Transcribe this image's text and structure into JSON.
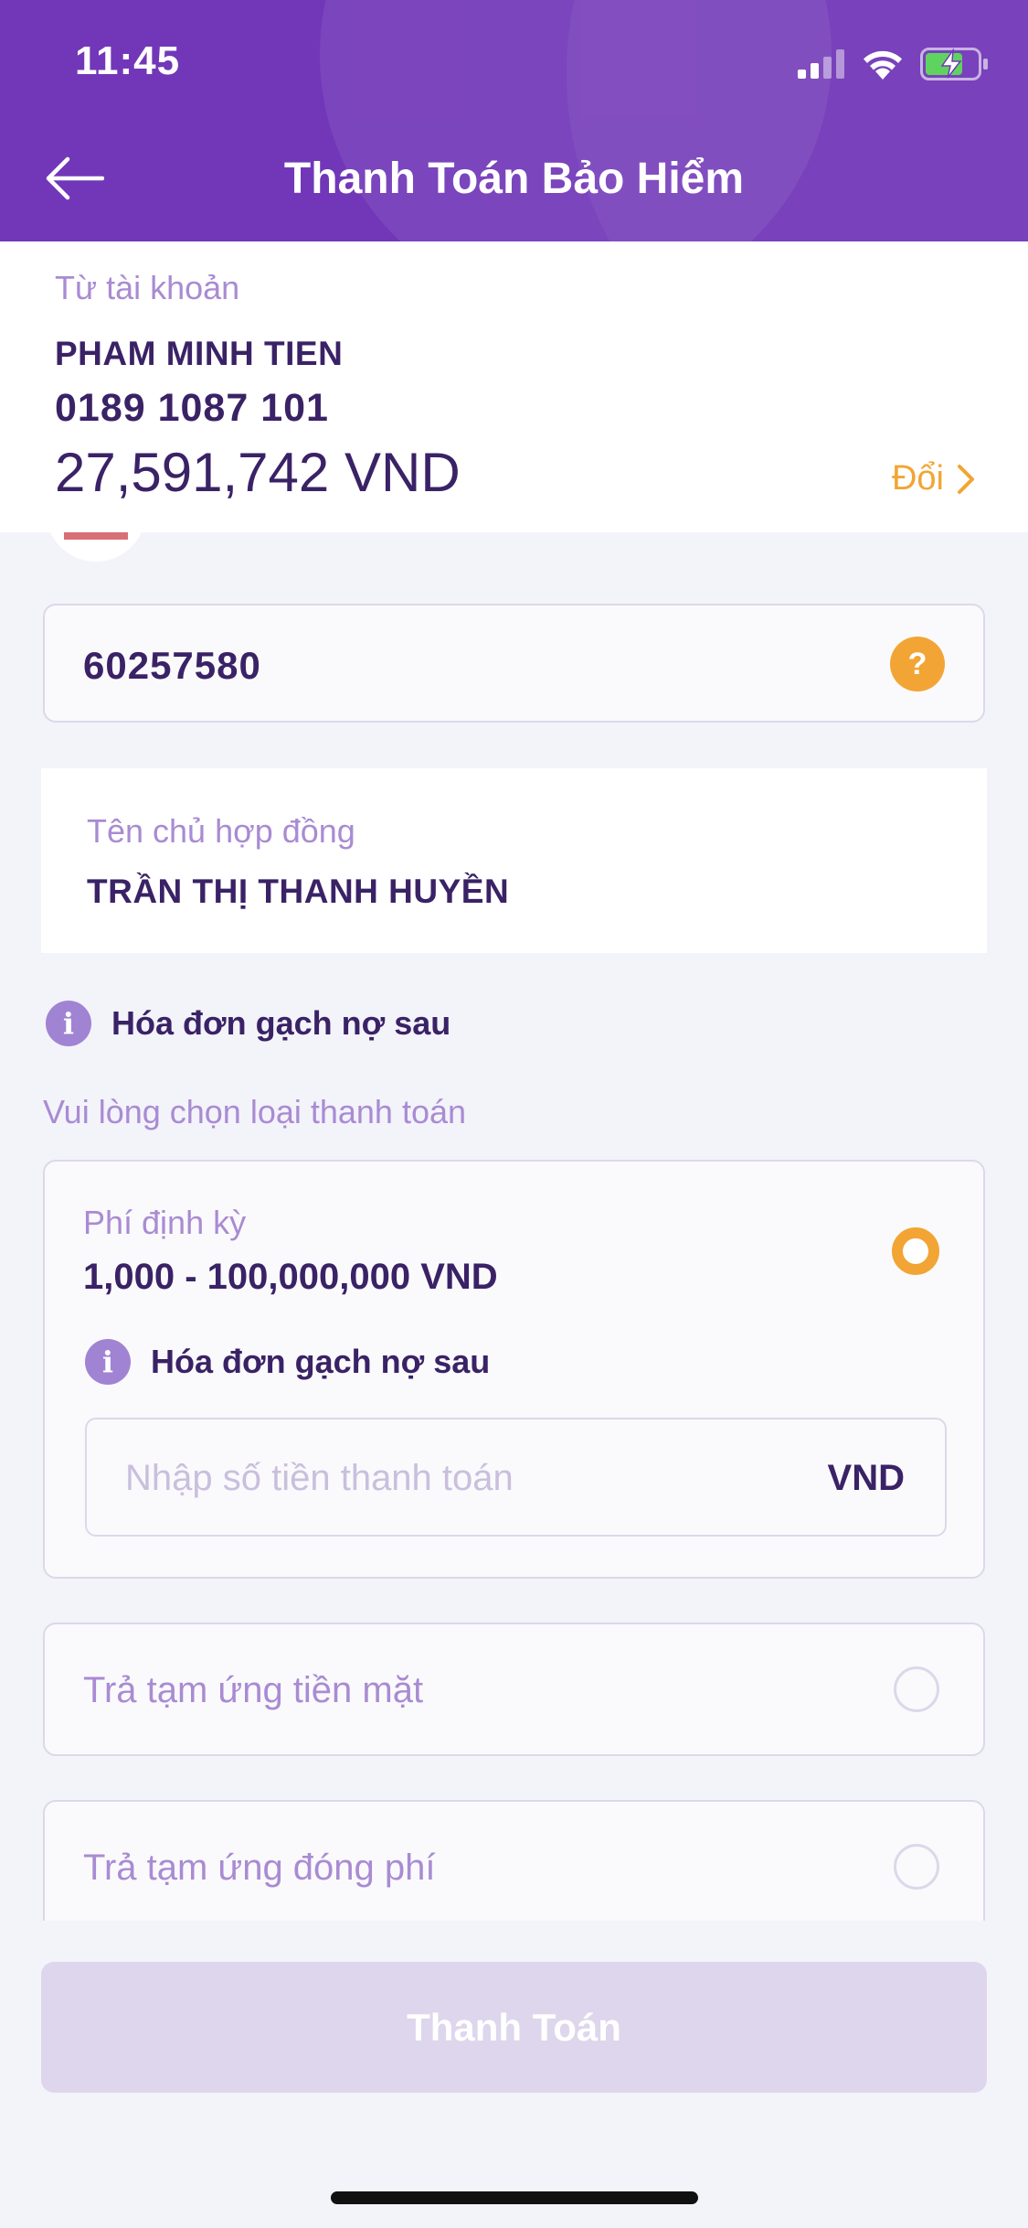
{
  "status_bar": {
    "time": "11:45"
  },
  "header": {
    "title": "Thanh Toán Bảo Hiểm"
  },
  "account": {
    "label": "Từ tài khoản",
    "name": "PHAM MINH TIEN",
    "number": "0189 1087 101",
    "balance": "27,591,742 VND",
    "change_label": "Đổi"
  },
  "contract": {
    "value": "60257580",
    "help_symbol": "?"
  },
  "owner": {
    "label": "Tên chủ hợp đồng",
    "value": "TRẦN THỊ THANH HUYỀN"
  },
  "info": {
    "icon_symbol": "i",
    "text": "Hóa đơn gạch nợ sau"
  },
  "payment_type": {
    "prompt": "Vui lòng chọn loại thanh toán",
    "options": [
      {
        "label": "Phí định kỳ",
        "range": "1,000 - 100,000,000 VND",
        "note": "Hóa đơn gạch nợ sau",
        "amount_placeholder": "Nhập số tiền thanh toán",
        "unit": "VND",
        "selected": true
      },
      {
        "label": "Trả tạm ứng tiền mặt",
        "selected": false
      },
      {
        "label": "Trả tạm ứng đóng phí",
        "selected": false
      }
    ]
  },
  "pay_button": {
    "label": "Thanh Toán"
  },
  "colors": {
    "header_bg": "#7237b8",
    "accent_orange": "#f2a534",
    "text_dark": "#3a2266",
    "text_muted": "#a98bd3",
    "button_disabled": "#ddd6ec"
  },
  "icons": {
    "back": "arrow-left-icon",
    "signal": "signal-icon",
    "wifi": "wifi-icon",
    "battery": "battery-charging-icon",
    "chevron": "chevron-right-icon",
    "help": "help-icon",
    "info": "info-icon"
  }
}
